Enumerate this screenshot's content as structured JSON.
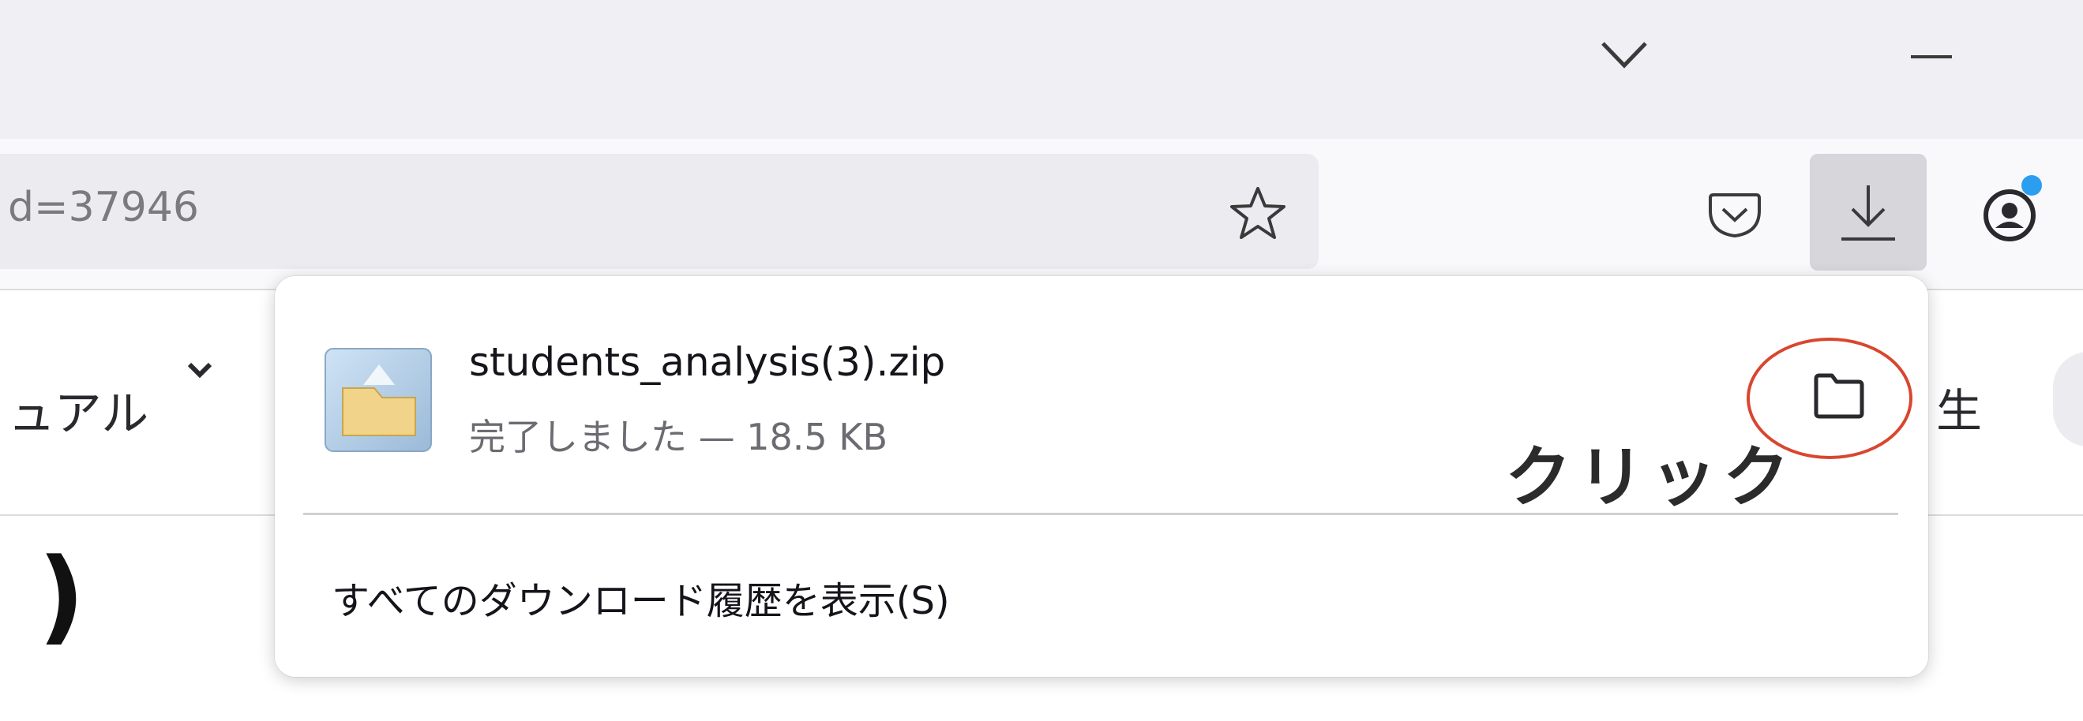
{
  "browser": {
    "url_fragment": "d=37946",
    "icons": {
      "bookmark": "star-icon",
      "tabs_list": "chevron-down-icon",
      "minimize": "minimize-icon",
      "pocket": "pocket-icon",
      "downloads": "download-icon",
      "account": "account-icon"
    }
  },
  "page": {
    "nav_left_label": "ュアル",
    "nav_right_label": "生",
    "heading_fragment": ")"
  },
  "downloads_panel": {
    "item": {
      "filename": "students_analysis(3).zip",
      "status": "完了しました — 18.5 KB",
      "icon": "zip-file-icon",
      "action_icon": "folder-icon"
    },
    "show_all_label": "すべてのダウンロード履歴を表示(S)"
  },
  "annotation": {
    "label": "クリック",
    "color": "#d9462f"
  }
}
